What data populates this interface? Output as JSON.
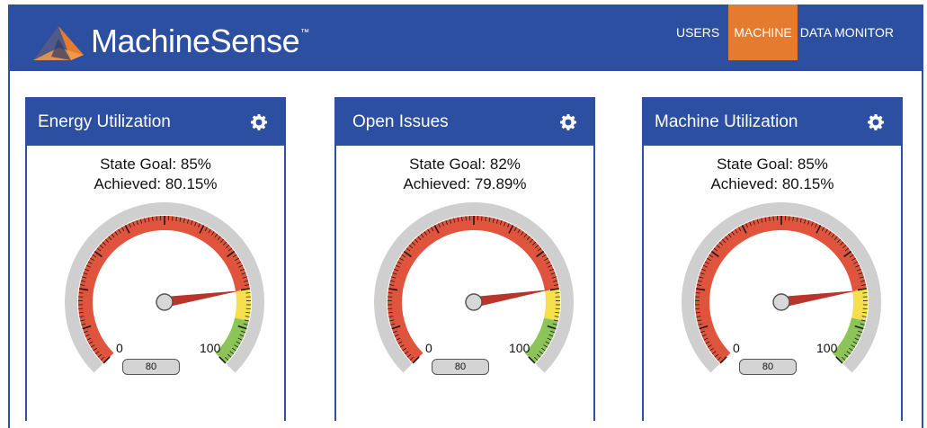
{
  "app": {
    "brand": "MachineSense",
    "trademark": "™"
  },
  "nav": {
    "items": [
      {
        "label": "USERS",
        "active": false
      },
      {
        "label": "MACHINE",
        "active": true
      },
      {
        "label": "DATA MONITOR",
        "active": false
      }
    ]
  },
  "panels": [
    {
      "title": "Energy Utilization",
      "goal_text": "State Goal: 85%",
      "achieved_text": "Achieved: 80.15%",
      "gauge": {
        "min_label": "0",
        "max_label": "100",
        "readout": "80",
        "value": 80.15
      }
    },
    {
      "title": "Open Issues",
      "goal_text": "State Goal: 82%",
      "achieved_text": "Achieved: 79.89%",
      "gauge": {
        "min_label": "0",
        "max_label": "100",
        "readout": "80",
        "value": 79.89
      }
    },
    {
      "title": "Machine Utilization",
      "goal_text": "State Goal: 85%",
      "achieved_text": "Achieved: 80.15%",
      "gauge": {
        "min_label": "0",
        "max_label": "100",
        "readout": "80",
        "value": 80.15
      }
    }
  ],
  "colors": {
    "header_blue": "#2d4fa1",
    "nav_active": "#e57b2f",
    "gauge_red": "#e0533c",
    "gauge_yellow": "#f5df4d",
    "gauge_green": "#8cc45a",
    "needle": "#b9342a"
  },
  "icons": {
    "logo": "machinesense-logo-icon",
    "settings": "gear-icon"
  }
}
